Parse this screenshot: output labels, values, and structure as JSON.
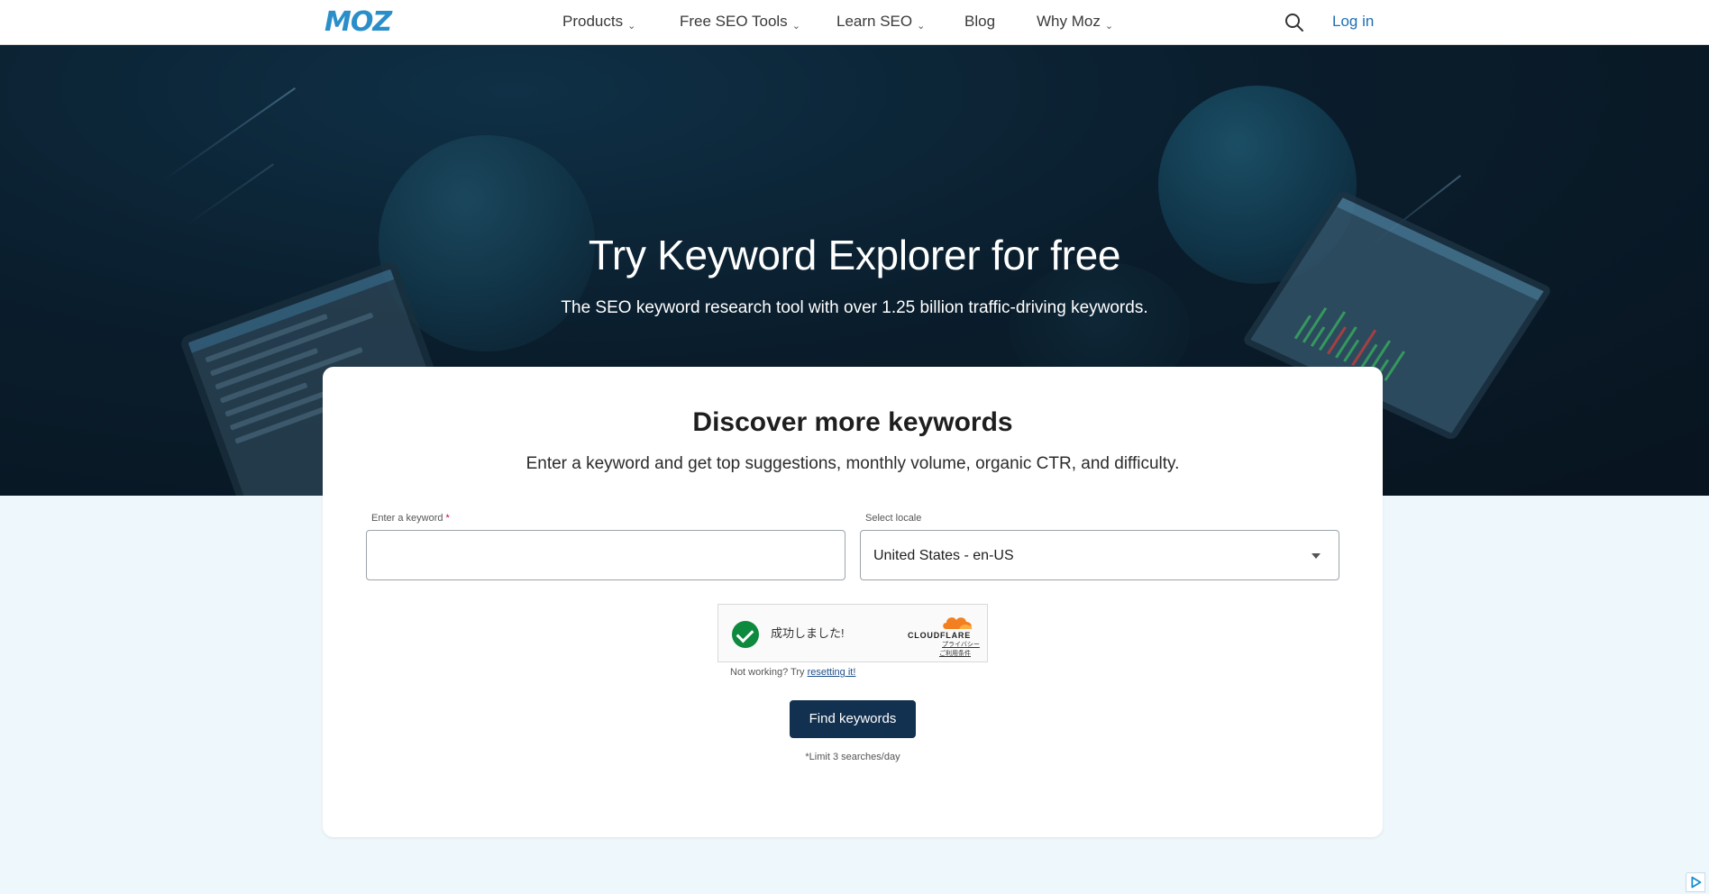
{
  "header": {
    "logo": "MOZ",
    "nav": [
      {
        "label": "Products",
        "has_dropdown": true
      },
      {
        "label": "Free SEO Tools",
        "has_dropdown": true
      },
      {
        "label": "Learn SEO",
        "has_dropdown": true
      },
      {
        "label": "Blog",
        "has_dropdown": false
      },
      {
        "label": "Why Moz",
        "has_dropdown": true
      }
    ],
    "chevron": "⌄",
    "search_icon": "search-icon",
    "login": "Log in"
  },
  "hero": {
    "title": "Try Keyword Explorer for free",
    "subtitle": "The SEO keyword research tool with over 1.25 billion traffic-driving keywords."
  },
  "card": {
    "title": "Discover more keywords",
    "subtitle": "Enter a keyword and get top suggestions, monthly volume, organic CTR, and difficulty.",
    "keyword_field": {
      "label": "Enter a keyword",
      "required_mark": "*",
      "value": "",
      "placeholder": ""
    },
    "locale_field": {
      "label": "Select locale",
      "value": "United States - en-US"
    },
    "captcha": {
      "status": "成功しました!",
      "provider": "CLOUDFLARE",
      "link_privacy": "プライバシー",
      "link_terms": "ご利用条件"
    },
    "reset_note": {
      "prefix": "Not working? Try ",
      "link": "resetting it!"
    },
    "button": "Find keywords",
    "limit_note": "*Limit 3 searches/day"
  },
  "colors": {
    "brand_blue": "#2a8fc9",
    "hero_bg": "#0a1d2c",
    "button_bg": "#12304f",
    "page_bg": "#eef7fb",
    "success_green": "#0e8a3e",
    "cloudflare_orange": "#f38020"
  }
}
